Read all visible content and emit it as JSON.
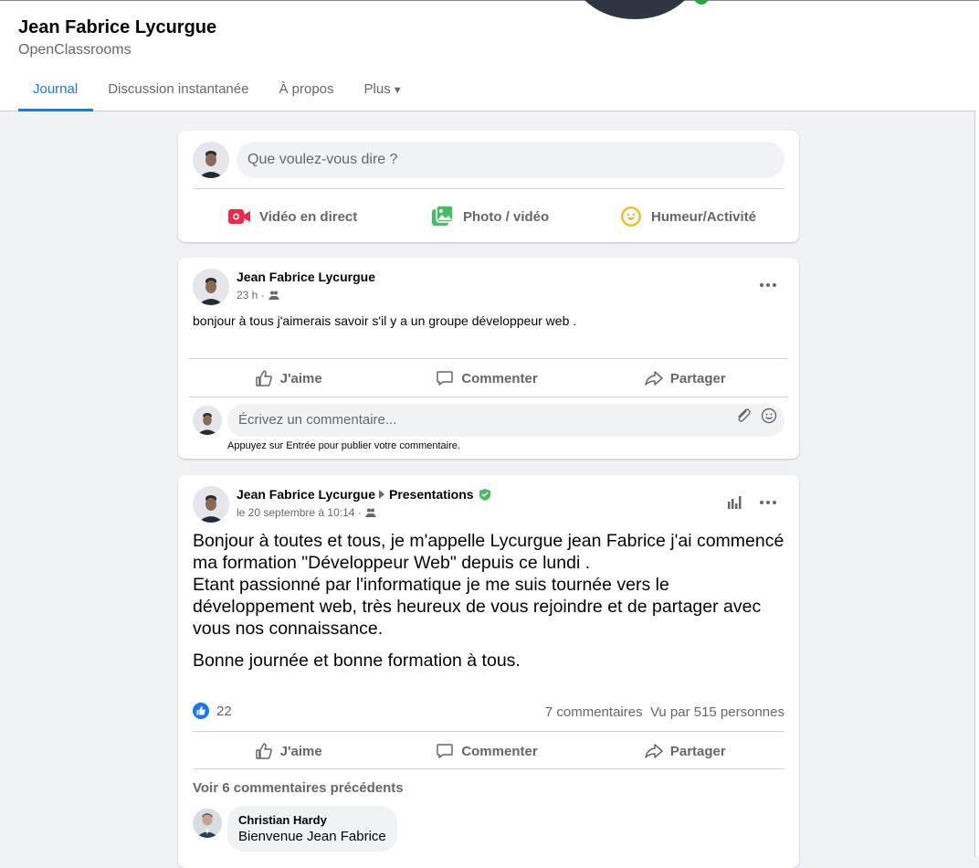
{
  "profile": {
    "name": "Jean Fabrice Lycurgue",
    "subtitle": "OpenClassrooms"
  },
  "tabs": [
    {
      "label": "Journal",
      "active": true
    },
    {
      "label": "Discussion instantanée"
    },
    {
      "label": "À propos"
    },
    {
      "label": "Plus"
    }
  ],
  "composer": {
    "placeholder": "Que voulez-vous dire ?",
    "actions": [
      {
        "label": "Vidéo en direct",
        "icon": "live-video-icon",
        "color": "#f02849"
      },
      {
        "label": "Photo / vidéo",
        "icon": "photo-icon",
        "color": "#45bd62"
      },
      {
        "label": "Humeur/Activité",
        "icon": "feeling-icon",
        "color": "#f7b928"
      }
    ]
  },
  "post1": {
    "author": "Jean Fabrice Lycurgue",
    "time": "23 h ·",
    "text": "bonjour à tous j'aimerais savoir s'il y a un groupe développeur web .",
    "actions": {
      "like": "J'aime",
      "comment": "Commenter",
      "share": "Partager"
    },
    "comment_placeholder": "Écrivez un commentaire...",
    "hint": "Appuyez sur Entrée pour publier votre commentaire."
  },
  "post2": {
    "author": "Jean Fabrice Lycurgue",
    "group": "Presentations",
    "time": "le 20 septembre à 10:14 ·",
    "paragraph1": "Bonjour à toutes et tous, je m'appelle Lycurgue jean Fabrice j'ai commencé ma formation \"Développeur Web\" depuis ce lundi .\nEtant passionné par l'informatique je me suis tournée vers le développement web, très heureux de vous rejoindre et de partager avec vous nos connaissance.",
    "paragraph2": "Bonne journée et bonne formation à tous.",
    "reactions": "22",
    "comments_count": "7 commentaires",
    "views": "Vu par 515 personnes",
    "actions": {
      "like": "J'aime",
      "comment": "Commenter",
      "share": "Partager"
    },
    "previous_comments": "Voir 6 commentaires précédents",
    "comment": {
      "author": "Christian Hardy",
      "text": "Bienvenue Jean Fabrice"
    }
  },
  "colors": {
    "accent": "#1877f2",
    "background": "#f0f2f5",
    "secondary_text": "#65676b",
    "group_badge": "#45bd62"
  }
}
